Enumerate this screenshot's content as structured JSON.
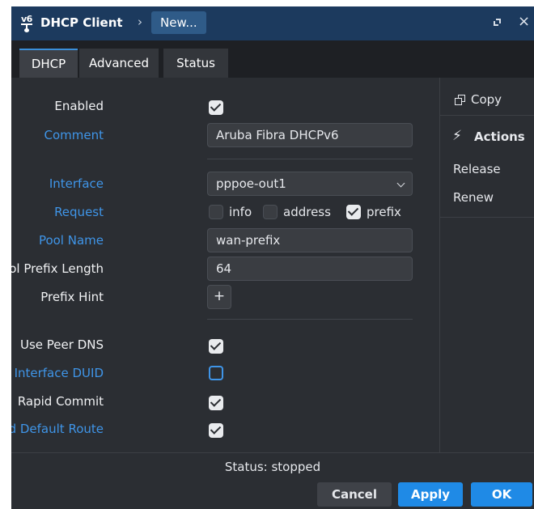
{
  "titlebar": {
    "app_title": "DHCP Client",
    "separator": "›",
    "crumb": "New...",
    "icon_text": "v6"
  },
  "tabs": [
    {
      "label": "DHCP",
      "active": true
    },
    {
      "label": "Advanced",
      "active": false
    },
    {
      "label": "Status",
      "active": false
    }
  ],
  "form": {
    "enabled": {
      "label": "Enabled",
      "checked": true
    },
    "comment": {
      "label": "Comment",
      "value": "Aruba Fibra DHCPv6"
    },
    "interface": {
      "label": "Interface",
      "value": "pppoe-out1"
    },
    "request": {
      "label": "Request",
      "options": [
        {
          "label": "info",
          "checked": false
        },
        {
          "label": "address",
          "checked": false
        },
        {
          "label": "prefix",
          "checked": true
        }
      ]
    },
    "pool_name": {
      "label": "Pool Name",
      "value": "wan-prefix"
    },
    "pool_prefix_length": {
      "label": "Pool Prefix Length",
      "value": "64"
    },
    "prefix_hint": {
      "label": "Prefix Hint",
      "button": "+"
    },
    "use_peer_dns": {
      "label": "Use Peer DNS",
      "checked": true
    },
    "use_interface_duid": {
      "label": "Use Interface DUID",
      "checked": false
    },
    "rapid_commit": {
      "label": "Rapid Commit",
      "checked": true
    },
    "add_default_route": {
      "label": "Add Default Route",
      "checked": true
    }
  },
  "side": {
    "copy": "Copy",
    "actions": "Actions",
    "items": [
      "Release",
      "Renew"
    ]
  },
  "status": "Status: stopped",
  "buttons": {
    "cancel": "Cancel",
    "apply": "Apply",
    "ok": "OK"
  },
  "colors": {
    "titlebar": "#1c3a5e",
    "accent": "#1f8ae6",
    "label_blue": "#3f95e8",
    "panel": "#2b2e33"
  }
}
